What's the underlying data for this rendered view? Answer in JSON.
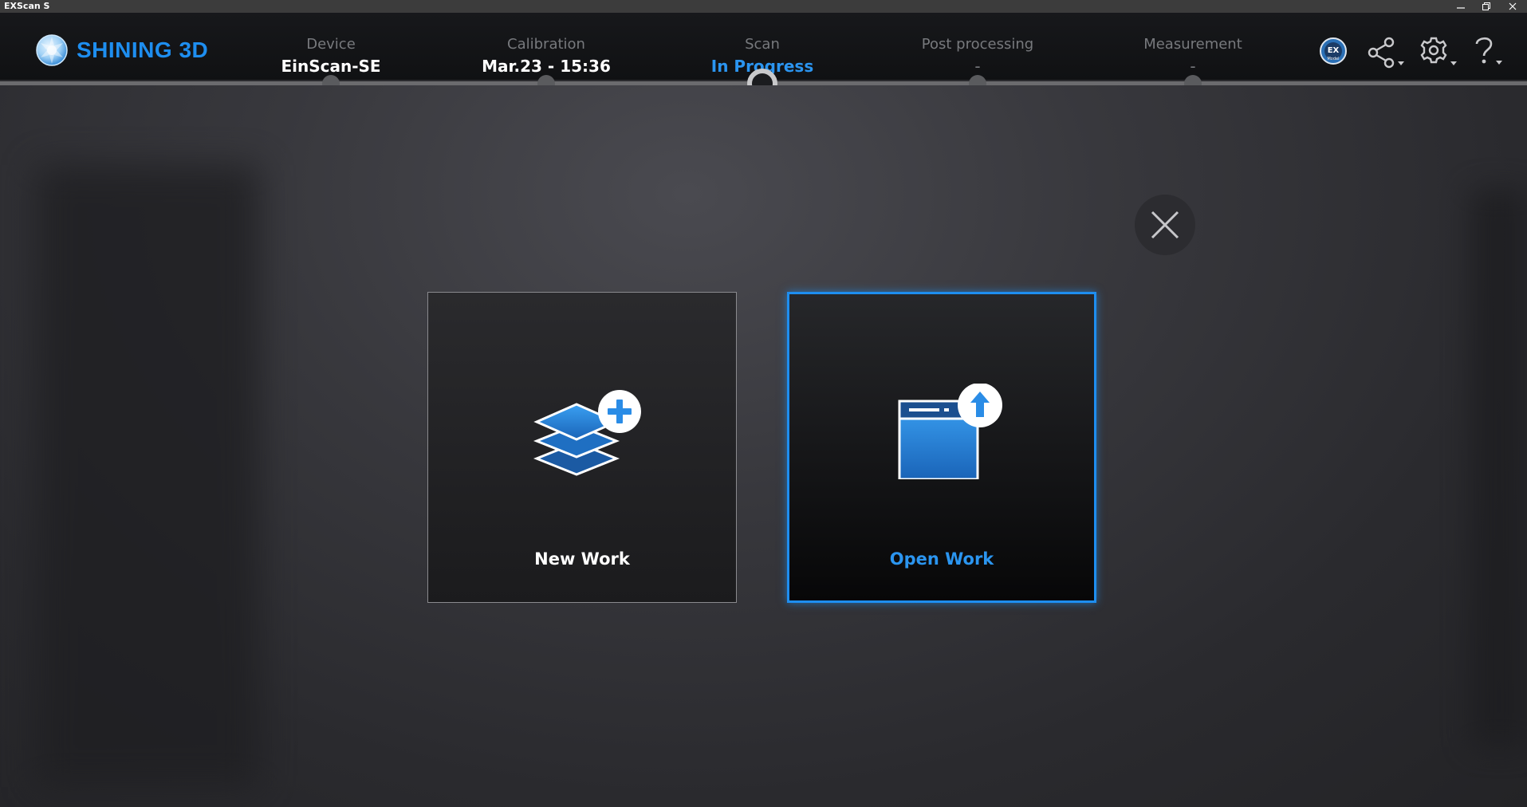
{
  "window": {
    "title": "EXScan S"
  },
  "brand": {
    "name": "SHINING 3D",
    "color": "#1e8ef0"
  },
  "steps": [
    {
      "label": "Device",
      "value": "EinScan-SE"
    },
    {
      "label": "Calibration",
      "value": "Mar.23 - 15:36"
    },
    {
      "label": "Scan",
      "value": "In Progress"
    },
    {
      "label": "Post processing",
      "value": "-"
    },
    {
      "label": "Measurement",
      "value": "-"
    }
  ],
  "current_step": "Scan",
  "header_icons": [
    "ex-model-icon",
    "share-icon",
    "settings-icon",
    "help-icon"
  ],
  "dialog": {
    "new_work": {
      "label": "New Work",
      "icon": "new-project-layers-icon"
    },
    "open_work": {
      "label": "Open Work",
      "icon": "open-project-icon"
    },
    "close_icon": "close-icon"
  },
  "colors": {
    "accent": "#1e8ef0",
    "header_bg": "#141518",
    "stage_bg": "#38383d"
  }
}
